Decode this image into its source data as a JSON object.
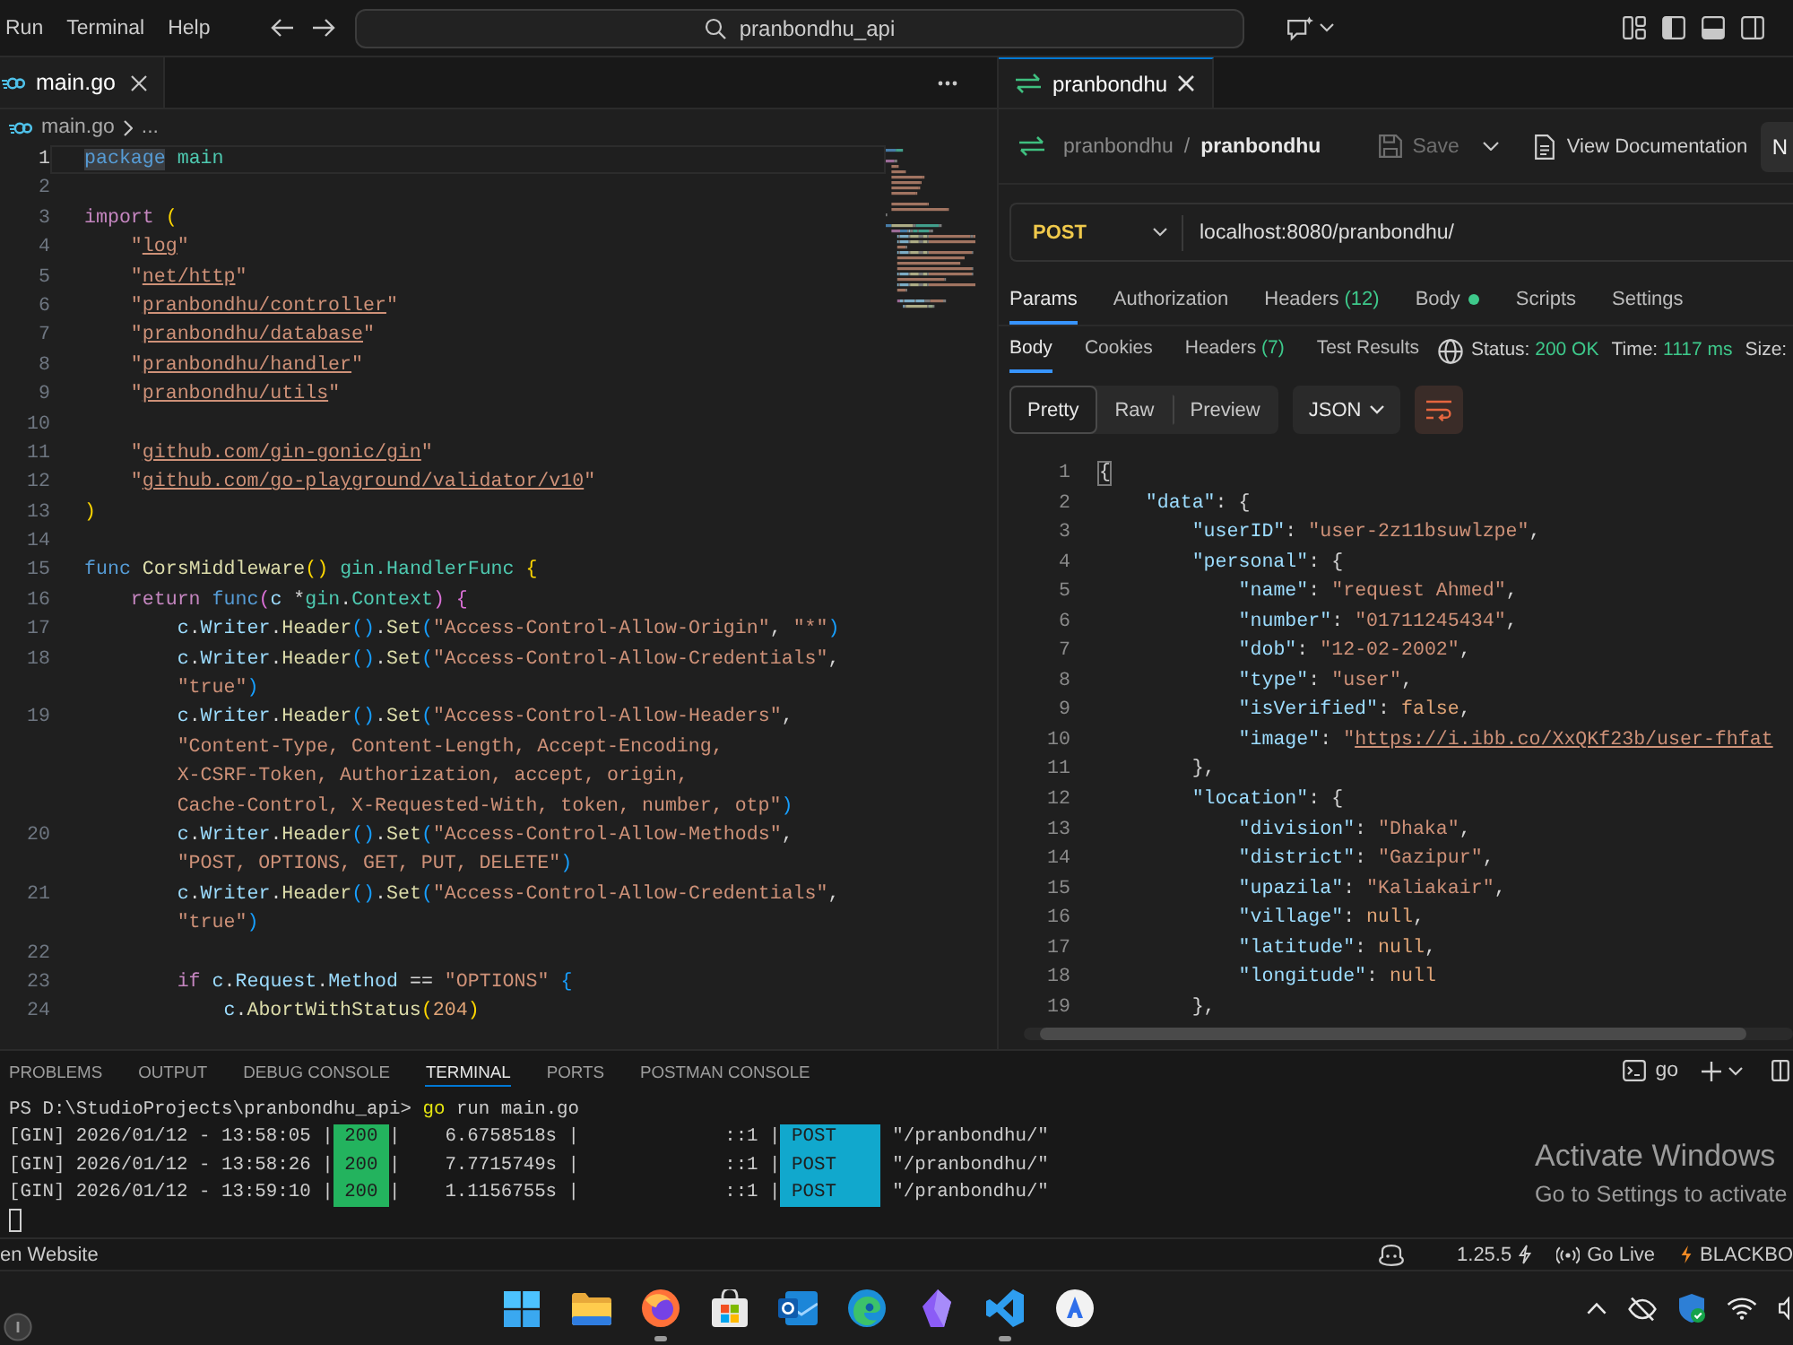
{
  "title_bar": {
    "menu": [
      "Run",
      "Terminal",
      "Help"
    ],
    "command_center": "pranbondhu_api"
  },
  "editor": {
    "tabs": [
      {
        "label": "main.go",
        "selected": true
      }
    ],
    "breadcrumb": {
      "file": "main.go",
      "more": "..."
    },
    "lines": [
      {
        "number": "1",
        "current": true,
        "segments": [
          {
            "tokens": [
              {
                "text": "package",
                "kind": "keyword",
                "highlighted": true
              },
              {
                "text": " main",
                "kind": "type"
              }
            ]
          }
        ]
      },
      {
        "number": "2",
        "current": false
      },
      {
        "number": "3",
        "current": false,
        "segments": [
          {
            "tokens": [
              {
                "text": "import",
                "kind": "control"
              },
              {
                "text": " (",
                "kind": "bracket1"
              }
            ]
          }
        ]
      },
      {
        "number": "4",
        "current": false,
        "segments": [
          {
            "tokens": [
              {
                "text": "    \"",
                "kind": "string"
              },
              {
                "text": "log",
                "kind": "link"
              },
              {
                "text": "\"",
                "kind": "string"
              }
            ]
          }
        ]
      },
      {
        "number": "5",
        "current": false,
        "segments": [
          {
            "tokens": [
              {
                "text": "    \"",
                "kind": "string"
              },
              {
                "text": "net/http",
                "kind": "link"
              },
              {
                "text": "\"",
                "kind": "string"
              }
            ]
          }
        ]
      },
      {
        "number": "6",
        "current": false,
        "segments": [
          {
            "tokens": [
              {
                "text": "    \"",
                "kind": "string"
              },
              {
                "text": "pranbondhu/controller",
                "kind": "link"
              },
              {
                "text": "\"",
                "kind": "string"
              }
            ]
          }
        ]
      },
      {
        "number": "7",
        "current": false,
        "segments": [
          {
            "tokens": [
              {
                "text": "    \"",
                "kind": "string"
              },
              {
                "text": "pranbondhu/database",
                "kind": "link"
              },
              {
                "text": "\"",
                "kind": "string"
              }
            ]
          }
        ]
      },
      {
        "number": "8",
        "current": false,
        "segments": [
          {
            "tokens": [
              {
                "text": "    \"",
                "kind": "string"
              },
              {
                "text": "pranbondhu/handler",
                "kind": "link"
              },
              {
                "text": "\"",
                "kind": "string"
              }
            ]
          }
        ]
      },
      {
        "number": "9",
        "current": false,
        "segments": [
          {
            "tokens": [
              {
                "text": "    \"",
                "kind": "string"
              },
              {
                "text": "pranbondhu/utils",
                "kind": "link"
              },
              {
                "text": "\"",
                "kind": "string"
              }
            ]
          }
        ]
      },
      {
        "number": "10",
        "current": false
      },
      {
        "number": "11",
        "current": false,
        "segments": [
          {
            "tokens": [
              {
                "text": "    \"",
                "kind": "string"
              },
              {
                "text": "github.com/gin-gonic/gin",
                "kind": "link"
              },
              {
                "text": "\"",
                "kind": "string"
              }
            ]
          }
        ]
      },
      {
        "number": "12",
        "current": false,
        "segments": [
          {
            "tokens": [
              {
                "text": "    \"",
                "kind": "string"
              },
              {
                "text": "github.com/go-playground/validator/v10",
                "kind": "link"
              },
              {
                "text": "\"",
                "kind": "string"
              }
            ]
          }
        ]
      },
      {
        "number": "13",
        "current": false,
        "segments": [
          {
            "tokens": [
              {
                "text": ")",
                "kind": "bracket1"
              }
            ]
          }
        ]
      },
      {
        "number": "14",
        "current": false
      },
      {
        "number": "15",
        "current": false,
        "segments": [
          {
            "tokens": [
              {
                "text": "func",
                "kind": "keyword"
              },
              {
                "text": " CorsMiddleware",
                "kind": "function"
              },
              {
                "text": "()",
                "kind": "bracket1"
              },
              {
                "text": " gin.HandlerFunc",
                "kind": "type"
              },
              {
                "text": " {",
                "kind": "bracket1"
              }
            ]
          }
        ]
      },
      {
        "number": "16",
        "current": false,
        "segments": [
          {
            "tokens": [
              {
                "text": "    return",
                "kind": "control"
              },
              {
                "text": " func",
                "kind": "keyword"
              },
              {
                "text": "(",
                "kind": "bracket2"
              },
              {
                "text": "c",
                "kind": "variable"
              },
              {
                "text": " *",
                "kind": "plain"
              },
              {
                "text": "gin",
                "kind": "type"
              },
              {
                "text": ".",
                "kind": "plain"
              },
              {
                "text": "Context",
                "kind": "type"
              },
              {
                "text": ")",
                "kind": "bracket2"
              },
              {
                "text": " {",
                "kind": "bracket2"
              }
            ]
          }
        ]
      },
      {
        "number": "17",
        "current": false,
        "segments": [
          {
            "tokens": [
              {
                "text": "        c",
                "kind": "variable"
              },
              {
                "text": ".",
                "kind": "plain"
              },
              {
                "text": "Writer",
                "kind": "variable"
              },
              {
                "text": ".",
                "kind": "plain"
              },
              {
                "text": "Header",
                "kind": "function"
              },
              {
                "text": "()",
                "kind": "bracket3"
              },
              {
                "text": ".",
                "kind": "plain"
              },
              {
                "text": "Set",
                "kind": "function"
              },
              {
                "text": "(",
                "kind": "bracket3"
              },
              {
                "text": "\"Access-Control-Allow-Origin\"",
                "kind": "string"
              },
              {
                "text": ", ",
                "kind": "plain"
              },
              {
                "text": "\"*\"",
                "kind": "string"
              },
              {
                "text": ")",
                "kind": "bracket3"
              }
            ]
          }
        ]
      },
      {
        "number": "18",
        "current": false,
        "segments": [
          {
            "tokens": [
              {
                "text": "        c",
                "kind": "variable"
              },
              {
                "text": ".",
                "kind": "plain"
              },
              {
                "text": "Writer",
                "kind": "variable"
              },
              {
                "text": ".",
                "kind": "plain"
              },
              {
                "text": "Header",
                "kind": "function"
              },
              {
                "text": "()",
                "kind": "bracket3"
              },
              {
                "text": ".",
                "kind": "plain"
              },
              {
                "text": "Set",
                "kind": "function"
              },
              {
                "text": "(",
                "kind": "bracket3"
              },
              {
                "text": "\"Access-Control-Allow-Credentials\"",
                "kind": "string"
              },
              {
                "text": ",",
                "kind": "plain"
              }
            ]
          },
          {
            "tokens": [
              {
                "text": "        \"true\"",
                "kind": "string"
              },
              {
                "text": ")",
                "kind": "bracket3"
              }
            ]
          }
        ]
      },
      {
        "number": "19",
        "current": false,
        "segments": [
          {
            "tokens": [
              {
                "text": "        c",
                "kind": "variable"
              },
              {
                "text": ".",
                "kind": "plain"
              },
              {
                "text": "Writer",
                "kind": "variable"
              },
              {
                "text": ".",
                "kind": "plain"
              },
              {
                "text": "Header",
                "kind": "function"
              },
              {
                "text": "()",
                "kind": "bracket3"
              },
              {
                "text": ".",
                "kind": "plain"
              },
              {
                "text": "Set",
                "kind": "function"
              },
              {
                "text": "(",
                "kind": "bracket3"
              },
              {
                "text": "\"Access-Control-Allow-Headers\"",
                "kind": "string"
              },
              {
                "text": ",",
                "kind": "plain"
              }
            ]
          },
          {
            "tokens": [
              {
                "text": "        \"Content-Type, Content-Length, Accept-Encoding,",
                "kind": "string"
              }
            ]
          },
          {
            "tokens": [
              {
                "text": "        X-CSRF-Token, Authorization, accept, origin,",
                "kind": "string"
              }
            ]
          },
          {
            "tokens": [
              {
                "text": "        Cache-Control, X-Requested-With, token, number, otp\"",
                "kind": "string"
              },
              {
                "text": ")",
                "kind": "bracket3"
              }
            ]
          }
        ]
      },
      {
        "number": "20",
        "current": false,
        "segments": [
          {
            "tokens": [
              {
                "text": "        c",
                "kind": "variable"
              },
              {
                "text": ".",
                "kind": "plain"
              },
              {
                "text": "Writer",
                "kind": "variable"
              },
              {
                "text": ".",
                "kind": "plain"
              },
              {
                "text": "Header",
                "kind": "function"
              },
              {
                "text": "()",
                "kind": "bracket3"
              },
              {
                "text": ".",
                "kind": "plain"
              },
              {
                "text": "Set",
                "kind": "function"
              },
              {
                "text": "(",
                "kind": "bracket3"
              },
              {
                "text": "\"Access-Control-Allow-Methods\"",
                "kind": "string"
              },
              {
                "text": ",",
                "kind": "plain"
              }
            ]
          },
          {
            "tokens": [
              {
                "text": "        \"POST, OPTIONS, GET, PUT, DELETE\"",
                "kind": "string"
              },
              {
                "text": ")",
                "kind": "bracket3"
              }
            ]
          }
        ]
      },
      {
        "number": "21",
        "current": false,
        "segments": [
          {
            "tokens": [
              {
                "text": "        c",
                "kind": "variable"
              },
              {
                "text": ".",
                "kind": "plain"
              },
              {
                "text": "Writer",
                "kind": "variable"
              },
              {
                "text": ".",
                "kind": "plain"
              },
              {
                "text": "Header",
                "kind": "function"
              },
              {
                "text": "()",
                "kind": "bracket3"
              },
              {
                "text": ".",
                "kind": "plain"
              },
              {
                "text": "Set",
                "kind": "function"
              },
              {
                "text": "(",
                "kind": "bracket3"
              },
              {
                "text": "\"Access-Control-Allow-Credentials\"",
                "kind": "string"
              },
              {
                "text": ",",
                "kind": "plain"
              }
            ]
          },
          {
            "tokens": [
              {
                "text": "        \"true\"",
                "kind": "string"
              },
              {
                "text": ")",
                "kind": "bracket3"
              }
            ]
          }
        ]
      },
      {
        "number": "22",
        "current": false
      },
      {
        "number": "23",
        "current": false,
        "segments": [
          {
            "tokens": [
              {
                "text": "        if",
                "kind": "control"
              },
              {
                "text": " c",
                "kind": "variable"
              },
              {
                "text": ".",
                "kind": "plain"
              },
              {
                "text": "Request",
                "kind": "variable"
              },
              {
                "text": ".",
                "kind": "plain"
              },
              {
                "text": "Method",
                "kind": "variable"
              },
              {
                "text": " == ",
                "kind": "plain"
              },
              {
                "text": "\"OPTIONS\"",
                "kind": "string"
              },
              {
                "text": " {",
                "kind": "bracket3"
              }
            ]
          }
        ]
      },
      {
        "number": "24",
        "current": false,
        "segments": [
          {
            "tokens": [
              {
                "text": "            c",
                "kind": "variable"
              },
              {
                "text": ".",
                "kind": "plain"
              },
              {
                "text": "AbortWithStatus",
                "kind": "function"
              },
              {
                "text": "(",
                "kind": "bracket1"
              },
              {
                "text": "204",
                "kind": "number"
              },
              {
                "text": ")",
                "kind": "bracket1"
              }
            ]
          }
        ]
      }
    ]
  },
  "postman": {
    "tabs": [
      {
        "label": "pranbondhu",
        "selected": true
      }
    ],
    "breadcrumb": {
      "collection": "pranbondhu",
      "separator": "/",
      "request": "pranbondhu"
    },
    "save": {
      "label": "Save",
      "disabled": true
    },
    "documentation": "View Documentation",
    "cut_off_button": "N",
    "request": {
      "method": "POST",
      "url": "localhost:8080/pranbondhu/"
    },
    "request_tabs": [
      {
        "label": "Params",
        "selected": true,
        "dot": false
      },
      {
        "label": "Authorization",
        "selected": false,
        "dot": false
      },
      {
        "label": "Headers",
        "count": "(12)",
        "selected": false,
        "dot": false
      },
      {
        "label": "Body",
        "selected": false,
        "dot": true
      },
      {
        "label": "Scripts",
        "selected": false,
        "dot": false
      },
      {
        "label": "Settings",
        "selected": false,
        "dot": false
      }
    ],
    "response_tabs": [
      {
        "label": "Body",
        "selected": true
      },
      {
        "label": "Cookies",
        "selected": false
      },
      {
        "label": "Headers",
        "count": "(7)",
        "selected": false
      },
      {
        "label": "Test Results",
        "selected": false
      }
    ],
    "response_meta": [
      {
        "label": "Status:",
        "value": "200 OK"
      },
      {
        "label": "Time:",
        "value": "1117 ms"
      },
      {
        "label": "Size:"
      }
    ],
    "view_modes": [
      {
        "label": "Pretty",
        "selected": true
      },
      {
        "label": "Raw",
        "selected": false
      },
      {
        "label": "Preview",
        "selected": false
      }
    ],
    "format": "JSON",
    "body_lines": [
      {
        "number": "1",
        "tokens": [
          {
            "text": "{",
            "kind": "punct",
            "highlighted": true
          }
        ]
      },
      {
        "number": "2",
        "tokens": [
          {
            "text": "    \"data\"",
            "kind": "key"
          },
          {
            "text": ": {",
            "kind": "punct"
          }
        ]
      },
      {
        "number": "3",
        "tokens": [
          {
            "text": "        \"userID\"",
            "kind": "key"
          },
          {
            "text": ": ",
            "kind": "punct"
          },
          {
            "text": "\"user-2z11bsuwlzpe\"",
            "kind": "string"
          },
          {
            "text": ",",
            "kind": "punct"
          }
        ]
      },
      {
        "number": "4",
        "tokens": [
          {
            "text": "        \"personal\"",
            "kind": "key"
          },
          {
            "text": ": {",
            "kind": "punct"
          }
        ]
      },
      {
        "number": "5",
        "tokens": [
          {
            "text": "            \"name\"",
            "kind": "key"
          },
          {
            "text": ": ",
            "kind": "punct"
          },
          {
            "text": "\"request Ahmed\"",
            "kind": "string"
          },
          {
            "text": ",",
            "kind": "punct"
          }
        ]
      },
      {
        "number": "6",
        "tokens": [
          {
            "text": "            \"number\"",
            "kind": "key"
          },
          {
            "text": ": ",
            "kind": "punct"
          },
          {
            "text": "\"01711245434\"",
            "kind": "string"
          },
          {
            "text": ",",
            "kind": "punct"
          }
        ]
      },
      {
        "number": "7",
        "tokens": [
          {
            "text": "            \"dob\"",
            "kind": "key"
          },
          {
            "text": ": ",
            "kind": "punct"
          },
          {
            "text": "\"12-02-2002\"",
            "kind": "string"
          },
          {
            "text": ",",
            "kind": "punct"
          }
        ]
      },
      {
        "number": "8",
        "tokens": [
          {
            "text": "            \"type\"",
            "kind": "key"
          },
          {
            "text": ": ",
            "kind": "punct"
          },
          {
            "text": "\"user\"",
            "kind": "string"
          },
          {
            "text": ",",
            "kind": "punct"
          }
        ]
      },
      {
        "number": "9",
        "tokens": [
          {
            "text": "            \"isVerified\"",
            "kind": "key"
          },
          {
            "text": ": ",
            "kind": "punct"
          },
          {
            "text": "false",
            "kind": "literal"
          },
          {
            "text": ",",
            "kind": "punct"
          }
        ]
      },
      {
        "number": "10",
        "tokens": [
          {
            "text": "            \"image\"",
            "kind": "key"
          },
          {
            "text": ": ",
            "kind": "punct"
          },
          {
            "text": "\"",
            "kind": "string"
          },
          {
            "text": "https://i.ibb.co/XxQKf23b/user-fhfat",
            "kind": "link"
          }
        ]
      },
      {
        "number": "11",
        "tokens": [
          {
            "text": "        },",
            "kind": "punct"
          }
        ]
      },
      {
        "number": "12",
        "tokens": [
          {
            "text": "        \"location\"",
            "kind": "key"
          },
          {
            "text": ": {",
            "kind": "punct"
          }
        ]
      },
      {
        "number": "13",
        "tokens": [
          {
            "text": "            \"division\"",
            "kind": "key"
          },
          {
            "text": ": ",
            "kind": "punct"
          },
          {
            "text": "\"Dhaka\"",
            "kind": "string"
          },
          {
            "text": ",",
            "kind": "punct"
          }
        ]
      },
      {
        "number": "14",
        "tokens": [
          {
            "text": "            \"district\"",
            "kind": "key"
          },
          {
            "text": ": ",
            "kind": "punct"
          },
          {
            "text": "\"Gazipur\"",
            "kind": "string"
          },
          {
            "text": ",",
            "kind": "punct"
          }
        ]
      },
      {
        "number": "15",
        "tokens": [
          {
            "text": "            \"upazila\"",
            "kind": "key"
          },
          {
            "text": ": ",
            "kind": "punct"
          },
          {
            "text": "\"Kaliakair\"",
            "kind": "string"
          },
          {
            "text": ",",
            "kind": "punct"
          }
        ]
      },
      {
        "number": "16",
        "tokens": [
          {
            "text": "            \"village\"",
            "kind": "key"
          },
          {
            "text": ": ",
            "kind": "punct"
          },
          {
            "text": "null",
            "kind": "literal"
          },
          {
            "text": ",",
            "kind": "punct"
          }
        ]
      },
      {
        "number": "17",
        "tokens": [
          {
            "text": "            \"latitude\"",
            "kind": "key"
          },
          {
            "text": ": ",
            "kind": "punct"
          },
          {
            "text": "null",
            "kind": "literal"
          },
          {
            "text": ",",
            "kind": "punct"
          }
        ]
      },
      {
        "number": "18",
        "tokens": [
          {
            "text": "            \"longitude\"",
            "kind": "key"
          },
          {
            "text": ": ",
            "kind": "punct"
          },
          {
            "text": "null",
            "kind": "literal"
          }
        ]
      },
      {
        "number": "19",
        "tokens": [
          {
            "text": "        },",
            "kind": "punct"
          }
        ]
      }
    ]
  },
  "panel": {
    "tabs": [
      {
        "label": "PROBLEMS",
        "selected": false
      },
      {
        "label": "OUTPUT",
        "selected": false
      },
      {
        "label": "DEBUG CONSOLE",
        "selected": false
      },
      {
        "label": "TERMINAL",
        "selected": true
      },
      {
        "label": "PORTS",
        "selected": false
      },
      {
        "label": "POSTMAN CONSOLE",
        "selected": false
      }
    ],
    "terminal_name": "go",
    "prompt": {
      "path": "PS D:\\StudioProjects\\pranbondhu_api>",
      "command": "go",
      "arguments": "run main.go"
    },
    "logs": [
      {
        "text": "[GIN] 2026/01/12 - 13:58:05 |",
        "status": "200",
        "details": "|    6.6758518s |             ::1 |",
        "method": "POST",
        "path": "\"/pranbondhu/\""
      },
      {
        "text": "[GIN] 2026/01/12 - 13:58:26 |",
        "status": "200",
        "details": "|    7.7715749s |             ::1 |",
        "method": "POST",
        "path": "\"/pranbondhu/\""
      },
      {
        "text": "[GIN] 2026/01/12 - 13:59:10 |",
        "status": "200",
        "details": "|    1.1156755s |             ::1 |",
        "method": "POST",
        "path": "\"/pranbondhu/\""
      }
    ]
  },
  "activation_notice": {
    "title": "Activate Windows",
    "text": "Go to Settings to activate"
  },
  "status_bar": {
    "left": "en Website",
    "go_version": "1.25.5",
    "live_server": "Go Live",
    "extension": "BLACKBO"
  },
  "taskbar": {
    "apps": [
      {
        "kind": "start",
        "open": false
      },
      {
        "kind": "files",
        "open": false
      },
      {
        "kind": "fox",
        "open": true
      },
      {
        "kind": "store",
        "open": false
      },
      {
        "kind": "mail",
        "open": false
      },
      {
        "kind": "swirl",
        "open": false
      },
      {
        "kind": "crystal",
        "open": false
      },
      {
        "kind": "code",
        "open": true
      },
      {
        "kind": "letter",
        "open": false
      }
    ]
  }
}
